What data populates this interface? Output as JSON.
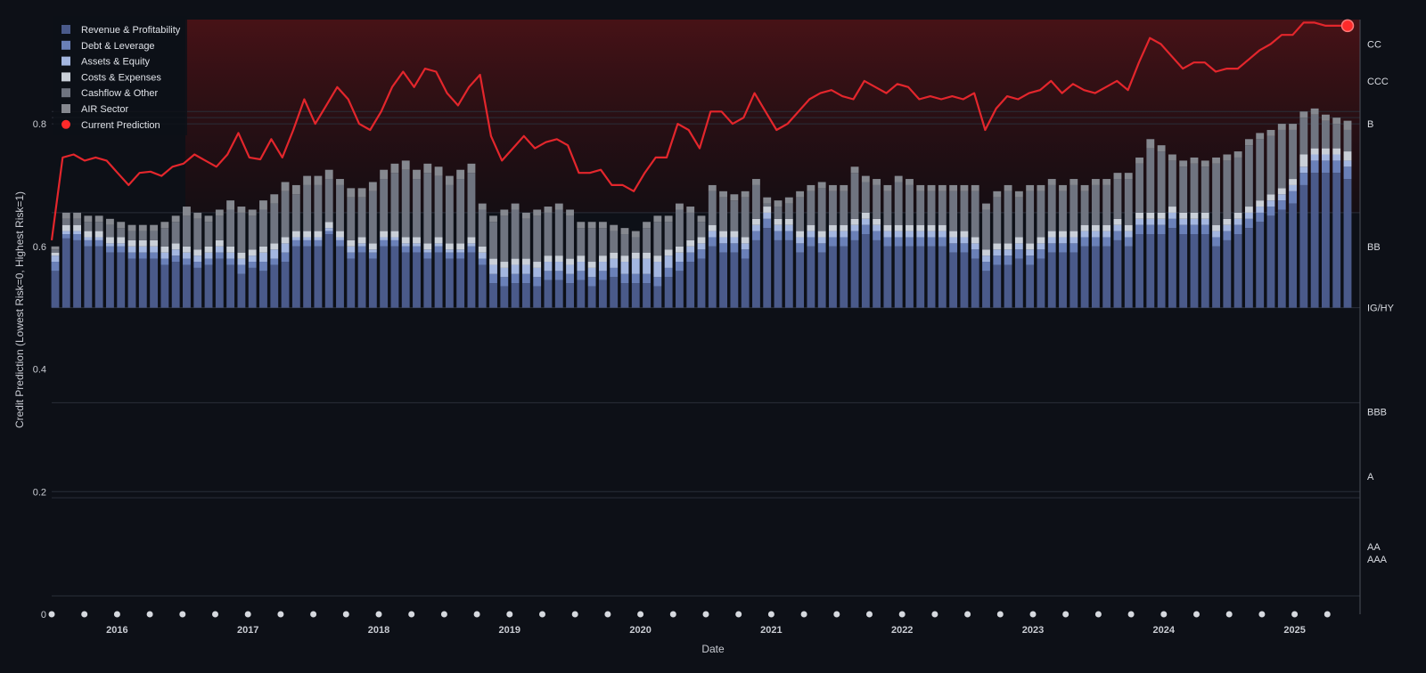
{
  "chart_data": {
    "type": "bar",
    "xlabel": "Date",
    "ylabel": "Credit Prediction (Lowest Risk=0, Highest Risk=1)",
    "ylim": [
      0,
      0.97
    ],
    "y_ticks": [
      0,
      0.2,
      0.4,
      0.6,
      0.8
    ],
    "x_start": 2015.5,
    "x_end": 2025.5,
    "years": [
      "2016",
      "2017",
      "2018",
      "2019",
      "2020",
      "2021",
      "2022",
      "2023",
      "2024",
      "2025"
    ],
    "bar_base": 0.5,
    "legend": [
      {
        "label": "Revenue & Profitability",
        "color": "#4a5a8a"
      },
      {
        "label": "Debt & Leverage",
        "color": "#6a80b8"
      },
      {
        "label": "Assets & Equity",
        "color": "#a3b6e0"
      },
      {
        "label": "Costs & Expenses",
        "color": "#c9cfd8"
      },
      {
        "label": "Cashflow & Other",
        "color": "#6f7480"
      },
      {
        "label": "AIR Sector",
        "color": "#85888f"
      },
      {
        "label": "Current Prediction",
        "color": "#ff2a2a"
      }
    ],
    "rating_bands": [
      {
        "label": "CC",
        "value": 0.93
      },
      {
        "label": "CCC",
        "value": 0.87
      },
      {
        "label": "B",
        "value": 0.8
      },
      {
        "label": "BB",
        "value": 0.6
      },
      {
        "label": "IG/HY",
        "value": 0.5
      },
      {
        "label": "BBB",
        "value": 0.33
      },
      {
        "label": "A",
        "value": 0.225
      },
      {
        "label": "AA",
        "value": 0.11
      },
      {
        "label": "AAA",
        "value": 0.09
      }
    ],
    "band_lines": [
      0.82,
      0.81,
      0.8,
      0.655,
      0.5,
      0.345,
      0.2,
      0.19,
      0.03
    ],
    "prediction_line": [
      0.61,
      0.745,
      0.75,
      0.74,
      0.745,
      0.74,
      0.72,
      0.7,
      0.72,
      0.722,
      0.715,
      0.73,
      0.735,
      0.75,
      0.74,
      0.73,
      0.75,
      0.785,
      0.745,
      0.742,
      0.775,
      0.745,
      0.79,
      0.84,
      0.8,
      0.83,
      0.86,
      0.84,
      0.8,
      0.79,
      0.82,
      0.86,
      0.885,
      0.86,
      0.89,
      0.885,
      0.85,
      0.83,
      0.86,
      0.88,
      0.78,
      0.74,
      0.76,
      0.78,
      0.76,
      0.77,
      0.775,
      0.765,
      0.72,
      0.72,
      0.725,
      0.7,
      0.7,
      0.69,
      0.72,
      0.745,
      0.745,
      0.8,
      0.79,
      0.76,
      0.82,
      0.82,
      0.8,
      0.81,
      0.85,
      0.82,
      0.79,
      0.8,
      0.82,
      0.84,
      0.85,
      0.855,
      0.845,
      0.84,
      0.87,
      0.86,
      0.85,
      0.865,
      0.86,
      0.84,
      0.845,
      0.84,
      0.845,
      0.84,
      0.85,
      0.79,
      0.825,
      0.845,
      0.84,
      0.85,
      0.855,
      0.87,
      0.85,
      0.865,
      0.855,
      0.85,
      0.86,
      0.87,
      0.855,
      0.9,
      0.94,
      0.93,
      0.91,
      0.89,
      0.9,
      0.9,
      0.885,
      0.89,
      0.89,
      0.905,
      0.92,
      0.93,
      0.945,
      0.945,
      0.965,
      0.965,
      0.96,
      0.96,
      0.96
    ],
    "stacked_bars": {
      "series_order": [
        "Revenue & Profitability",
        "Debt & Leverage",
        "Assets & Equity",
        "Costs & Expenses",
        "Cashflow & Other",
        "AIR Sector"
      ],
      "stack_tops": [
        [
          0.56,
          0.613,
          0.61,
          0.6,
          0.6,
          0.59,
          0.59,
          0.58,
          0.58,
          0.58,
          0.57,
          0.575,
          0.57,
          0.565,
          0.57,
          0.58,
          0.57,
          0.555,
          0.565,
          0.56,
          0.57,
          0.575,
          0.6,
          0.6,
          0.6,
          0.62,
          0.6,
          0.58,
          0.59,
          0.58,
          0.6,
          0.6,
          0.59,
          0.59,
          0.58,
          0.59,
          0.58,
          0.58,
          0.59,
          0.57,
          0.54,
          0.535,
          0.54,
          0.54,
          0.535,
          0.545,
          0.545,
          0.54,
          0.545,
          0.535,
          0.545,
          0.55,
          0.54,
          0.54,
          0.54,
          0.535,
          0.55,
          0.56,
          0.575,
          0.58,
          0.6,
          0.59,
          0.59,
          0.58,
          0.61,
          0.63,
          0.61,
          0.61,
          0.59,
          0.6,
          0.59,
          0.6,
          0.6,
          0.61,
          0.62,
          0.61,
          0.6,
          0.6,
          0.6,
          0.6,
          0.6,
          0.6,
          0.59,
          0.59,
          0.58,
          0.56,
          0.57,
          0.57,
          0.58,
          0.57,
          0.58,
          0.59,
          0.59,
          0.59,
          0.6,
          0.6,
          0.6,
          0.61,
          0.6,
          0.62,
          0.62,
          0.62,
          0.63,
          0.62,
          0.62,
          0.62,
          0.6,
          0.61,
          0.62,
          0.63,
          0.64,
          0.65,
          0.66,
          0.67,
          0.7,
          0.72,
          0.72,
          0.72,
          0.71
        ],
        [
          0.575,
          0.62,
          0.62,
          0.61,
          0.61,
          0.6,
          0.6,
          0.59,
          0.59,
          0.59,
          0.58,
          0.585,
          0.58,
          0.575,
          0.58,
          0.59,
          0.58,
          0.57,
          0.575,
          0.575,
          0.58,
          0.59,
          0.61,
          0.61,
          0.61,
          0.625,
          0.61,
          0.59,
          0.6,
          0.59,
          0.61,
          0.61,
          0.6,
          0.6,
          0.59,
          0.6,
          0.59,
          0.59,
          0.6,
          0.58,
          0.555,
          0.55,
          0.555,
          0.555,
          0.55,
          0.56,
          0.56,
          0.555,
          0.56,
          0.55,
          0.56,
          0.565,
          0.555,
          0.555,
          0.555,
          0.55,
          0.565,
          0.575,
          0.59,
          0.595,
          0.615,
          0.605,
          0.605,
          0.595,
          0.625,
          0.645,
          0.625,
          0.625,
          0.605,
          0.615,
          0.605,
          0.615,
          0.615,
          0.625,
          0.635,
          0.625,
          0.615,
          0.615,
          0.615,
          0.615,
          0.615,
          0.615,
          0.605,
          0.605,
          0.595,
          0.575,
          0.585,
          0.585,
          0.595,
          0.585,
          0.595,
          0.605,
          0.605,
          0.605,
          0.615,
          0.615,
          0.615,
          0.625,
          0.615,
          0.635,
          0.635,
          0.635,
          0.645,
          0.635,
          0.635,
          0.635,
          0.615,
          0.625,
          0.635,
          0.645,
          0.655,
          0.665,
          0.675,
          0.69,
          0.72,
          0.74,
          0.74,
          0.74,
          0.73
        ],
        [
          0.585,
          0.625,
          0.625,
          0.615,
          0.615,
          0.605,
          0.605,
          0.6,
          0.6,
          0.6,
          0.59,
          0.595,
          0.59,
          0.585,
          0.59,
          0.6,
          0.59,
          0.58,
          0.585,
          0.59,
          0.595,
          0.605,
          0.615,
          0.615,
          0.615,
          0.63,
          0.615,
          0.6,
          0.605,
          0.595,
          0.615,
          0.615,
          0.605,
          0.605,
          0.595,
          0.605,
          0.595,
          0.595,
          0.605,
          0.59,
          0.57,
          0.565,
          0.57,
          0.57,
          0.565,
          0.575,
          0.575,
          0.57,
          0.575,
          0.565,
          0.575,
          0.58,
          0.575,
          0.58,
          0.58,
          0.575,
          0.585,
          0.59,
          0.6,
          0.605,
          0.625,
          0.615,
          0.615,
          0.605,
          0.635,
          0.655,
          0.635,
          0.635,
          0.615,
          0.625,
          0.615,
          0.625,
          0.625,
          0.635,
          0.645,
          0.635,
          0.625,
          0.625,
          0.625,
          0.625,
          0.625,
          0.625,
          0.615,
          0.615,
          0.605,
          0.585,
          0.595,
          0.595,
          0.605,
          0.595,
          0.605,
          0.615,
          0.615,
          0.615,
          0.625,
          0.625,
          0.625,
          0.635,
          0.625,
          0.645,
          0.645,
          0.645,
          0.655,
          0.645,
          0.645,
          0.645,
          0.625,
          0.635,
          0.645,
          0.655,
          0.665,
          0.675,
          0.685,
          0.7,
          0.73,
          0.75,
          0.75,
          0.75,
          0.74
        ],
        [
          0.59,
          0.635,
          0.635,
          0.625,
          0.625,
          0.615,
          0.615,
          0.61,
          0.61,
          0.61,
          0.6,
          0.605,
          0.6,
          0.595,
          0.6,
          0.61,
          0.6,
          0.59,
          0.595,
          0.6,
          0.605,
          0.615,
          0.625,
          0.625,
          0.625,
          0.64,
          0.625,
          0.61,
          0.615,
          0.605,
          0.625,
          0.625,
          0.615,
          0.615,
          0.605,
          0.615,
          0.605,
          0.605,
          0.615,
          0.6,
          0.58,
          0.575,
          0.58,
          0.58,
          0.575,
          0.585,
          0.585,
          0.58,
          0.585,
          0.575,
          0.585,
          0.59,
          0.585,
          0.59,
          0.59,
          0.585,
          0.595,
          0.6,
          0.61,
          0.615,
          0.635,
          0.625,
          0.625,
          0.615,
          0.645,
          0.665,
          0.645,
          0.645,
          0.625,
          0.635,
          0.625,
          0.635,
          0.635,
          0.645,
          0.655,
          0.645,
          0.635,
          0.635,
          0.635,
          0.635,
          0.635,
          0.635,
          0.625,
          0.625,
          0.615,
          0.595,
          0.605,
          0.605,
          0.615,
          0.605,
          0.615,
          0.625,
          0.625,
          0.625,
          0.635,
          0.635,
          0.635,
          0.645,
          0.635,
          0.655,
          0.655,
          0.655,
          0.665,
          0.655,
          0.655,
          0.655,
          0.635,
          0.645,
          0.655,
          0.665,
          0.675,
          0.685,
          0.695,
          0.71,
          0.75,
          0.76,
          0.76,
          0.76,
          0.755
        ],
        [
          0.595,
          0.645,
          0.645,
          0.64,
          0.64,
          0.635,
          0.63,
          0.625,
          0.625,
          0.625,
          0.63,
          0.64,
          0.65,
          0.645,
          0.64,
          0.65,
          0.66,
          0.655,
          0.65,
          0.66,
          0.67,
          0.69,
          0.685,
          0.7,
          0.7,
          0.71,
          0.7,
          0.68,
          0.68,
          0.69,
          0.71,
          0.72,
          0.725,
          0.71,
          0.72,
          0.715,
          0.7,
          0.71,
          0.72,
          0.66,
          0.64,
          0.65,
          0.66,
          0.645,
          0.65,
          0.655,
          0.66,
          0.65,
          0.63,
          0.63,
          0.63,
          0.625,
          0.62,
          0.615,
          0.63,
          0.64,
          0.64,
          0.66,
          0.655,
          0.64,
          0.69,
          0.68,
          0.675,
          0.68,
          0.7,
          0.67,
          0.665,
          0.67,
          0.68,
          0.69,
          0.695,
          0.69,
          0.69,
          0.72,
          0.705,
          0.7,
          0.69,
          0.705,
          0.7,
          0.69,
          0.69,
          0.69,
          0.69,
          0.69,
          0.69,
          0.66,
          0.68,
          0.69,
          0.68,
          0.69,
          0.69,
          0.7,
          0.69,
          0.7,
          0.69,
          0.7,
          0.7,
          0.71,
          0.71,
          0.735,
          0.76,
          0.755,
          0.74,
          0.73,
          0.735,
          0.73,
          0.735,
          0.74,
          0.745,
          0.765,
          0.775,
          0.78,
          0.79,
          0.79,
          0.81,
          0.815,
          0.805,
          0.8,
          0.79
        ],
        [
          0.6,
          0.655,
          0.655,
          0.65,
          0.65,
          0.645,
          0.64,
          0.635,
          0.635,
          0.635,
          0.64,
          0.65,
          0.665,
          0.655,
          0.65,
          0.66,
          0.675,
          0.665,
          0.66,
          0.675,
          0.685,
          0.705,
          0.7,
          0.715,
          0.715,
          0.725,
          0.71,
          0.695,
          0.695,
          0.705,
          0.725,
          0.735,
          0.74,
          0.725,
          0.735,
          0.73,
          0.715,
          0.725,
          0.735,
          0.67,
          0.65,
          0.66,
          0.67,
          0.655,
          0.66,
          0.665,
          0.67,
          0.66,
          0.64,
          0.64,
          0.64,
          0.635,
          0.63,
          0.625,
          0.64,
          0.65,
          0.65,
          0.67,
          0.665,
          0.65,
          0.7,
          0.69,
          0.685,
          0.69,
          0.71,
          0.68,
          0.675,
          0.68,
          0.69,
          0.7,
          0.705,
          0.7,
          0.7,
          0.73,
          0.715,
          0.71,
          0.7,
          0.715,
          0.71,
          0.7,
          0.7,
          0.7,
          0.7,
          0.7,
          0.7,
          0.67,
          0.69,
          0.7,
          0.69,
          0.7,
          0.7,
          0.71,
          0.7,
          0.71,
          0.7,
          0.71,
          0.71,
          0.72,
          0.72,
          0.745,
          0.775,
          0.765,
          0.75,
          0.74,
          0.745,
          0.74,
          0.745,
          0.75,
          0.755,
          0.775,
          0.785,
          0.79,
          0.8,
          0.8,
          0.82,
          0.825,
          0.815,
          0.81,
          0.805
        ]
      ]
    }
  }
}
